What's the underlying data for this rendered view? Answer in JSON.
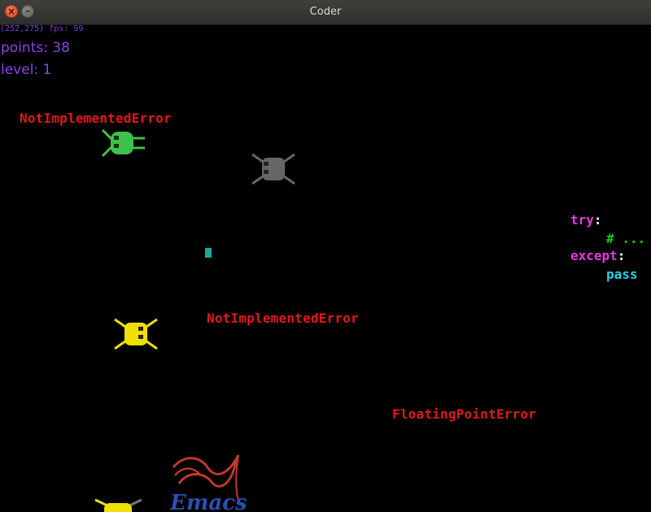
{
  "window": {
    "title": "Coder",
    "close_glyph": "×",
    "minimize_glyph": "–"
  },
  "hud": {
    "fps_text": "(252,275) fps: 99",
    "points_text": "points: 38",
    "level_text": "level: 1"
  },
  "errors": [
    "NotImplementedError",
    "NotImplementedError",
    "FloatingPointError"
  ],
  "code": {
    "line1_kw": "try",
    "line1_colon": ":",
    "line2": "# ...",
    "line3_kw": "except",
    "line3_colon": ":",
    "line4": "pass"
  },
  "bugs": [
    {
      "color": "#3cc24a",
      "orientation": "right"
    },
    {
      "color": "#666666",
      "orientation": "down"
    },
    {
      "color": "#f0e000",
      "orientation": "down"
    },
    {
      "color": "#f0e000",
      "orientation": "down"
    }
  ],
  "colors": {
    "error": "#e41818",
    "hud": "#8a45e6",
    "keyword": "#e43be0",
    "comment": "#22c81a",
    "pass": "#28d0e8",
    "player": "#1fa89a"
  },
  "logo": {
    "name": "emacs-logo",
    "text": "Emacs"
  }
}
